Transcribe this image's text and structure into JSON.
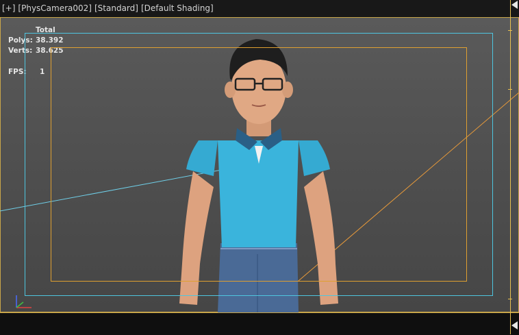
{
  "header": {
    "menu_label": "[+]",
    "camera_label": "[PhysCamera002]",
    "renderer_label": "[Standard]",
    "shading_label": "[Default Shading]"
  },
  "stats": {
    "total_label": "Total",
    "polys_label": "Polys:",
    "polys_value": "38.392",
    "verts_label": "Verts:",
    "verts_value": "38.625",
    "fps_label": "FPS:",
    "fps_value": "1"
  },
  "colors": {
    "safe_frame": "#4ec6e0",
    "action_frame": "#e0a030",
    "shirt": "#3ab4dc",
    "collar": "#2a5f86",
    "skin": "#e0a884",
    "jeans": "#4a6a96"
  },
  "icons": [
    "axis-gizmo-icon",
    "scroll-up-arrow-icon",
    "scroll-down-arrow-icon"
  ]
}
